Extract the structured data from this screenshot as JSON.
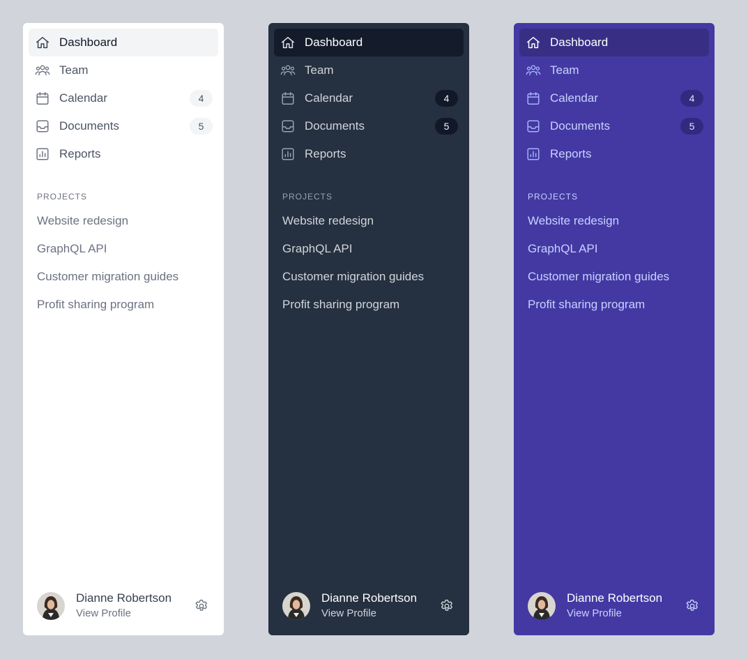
{
  "nav": {
    "items": [
      {
        "label": "Dashboard",
        "icon": "home-icon",
        "active": true,
        "badge": null
      },
      {
        "label": "Team",
        "icon": "users-icon",
        "active": false,
        "badge": null
      },
      {
        "label": "Calendar",
        "icon": "calendar-icon",
        "active": false,
        "badge": "4"
      },
      {
        "label": "Documents",
        "icon": "inbox-icon",
        "active": false,
        "badge": "5"
      },
      {
        "label": "Reports",
        "icon": "chart-bar-icon",
        "active": false,
        "badge": null
      }
    ]
  },
  "projects": {
    "heading": "PROJECTS",
    "items": [
      "Website redesign",
      "GraphQL API",
      "Customer migration guides",
      "Profit sharing program"
    ]
  },
  "profile": {
    "name": "Dianne Robertson",
    "link_label": "View Profile",
    "avatar_icon": "avatar-photo",
    "settings_icon": "gear-icon"
  },
  "themes": {
    "light": {
      "background": "#ffffff",
      "active_bg": "#f3f4f6"
    },
    "dark": {
      "background": "#253040",
      "active_bg": "#141c2b"
    },
    "indigo": {
      "background": "#4439a3",
      "active_bg": "#382f85"
    }
  },
  "page_background": "#d1d5db"
}
